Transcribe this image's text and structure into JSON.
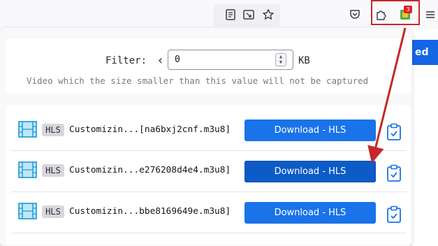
{
  "toolbar": {
    "icons": [
      "reader-view-icon",
      "screenshot-icon",
      "bookmark-star-icon",
      "pocket-icon",
      "extensions-puzzle-icon",
      "video-downloader-extension-icon",
      "menu-icon"
    ],
    "badge_count": "3"
  },
  "background_page": {
    "button_fragment": "ed"
  },
  "filter": {
    "label": "Filter:",
    "value": "0",
    "unit": "KB",
    "hint": "Video which the size smaller than this value will not be captured"
  },
  "videos": [
    {
      "tag": "HLS",
      "filename": "Customizin...[na6bxj2cnf.m3u8]",
      "button": "Download - HLS"
    },
    {
      "tag": "HLS",
      "filename": "Customizin...e276208d4e4.m3u8]",
      "button": "Download - HLS"
    },
    {
      "tag": "HLS",
      "filename": "Customizin...bbe8169649e.m3u8]",
      "button": "Download - HLS"
    }
  ],
  "colors": {
    "accent": "#1a73e8",
    "highlight": "#c62828",
    "badge": "#e02020"
  }
}
